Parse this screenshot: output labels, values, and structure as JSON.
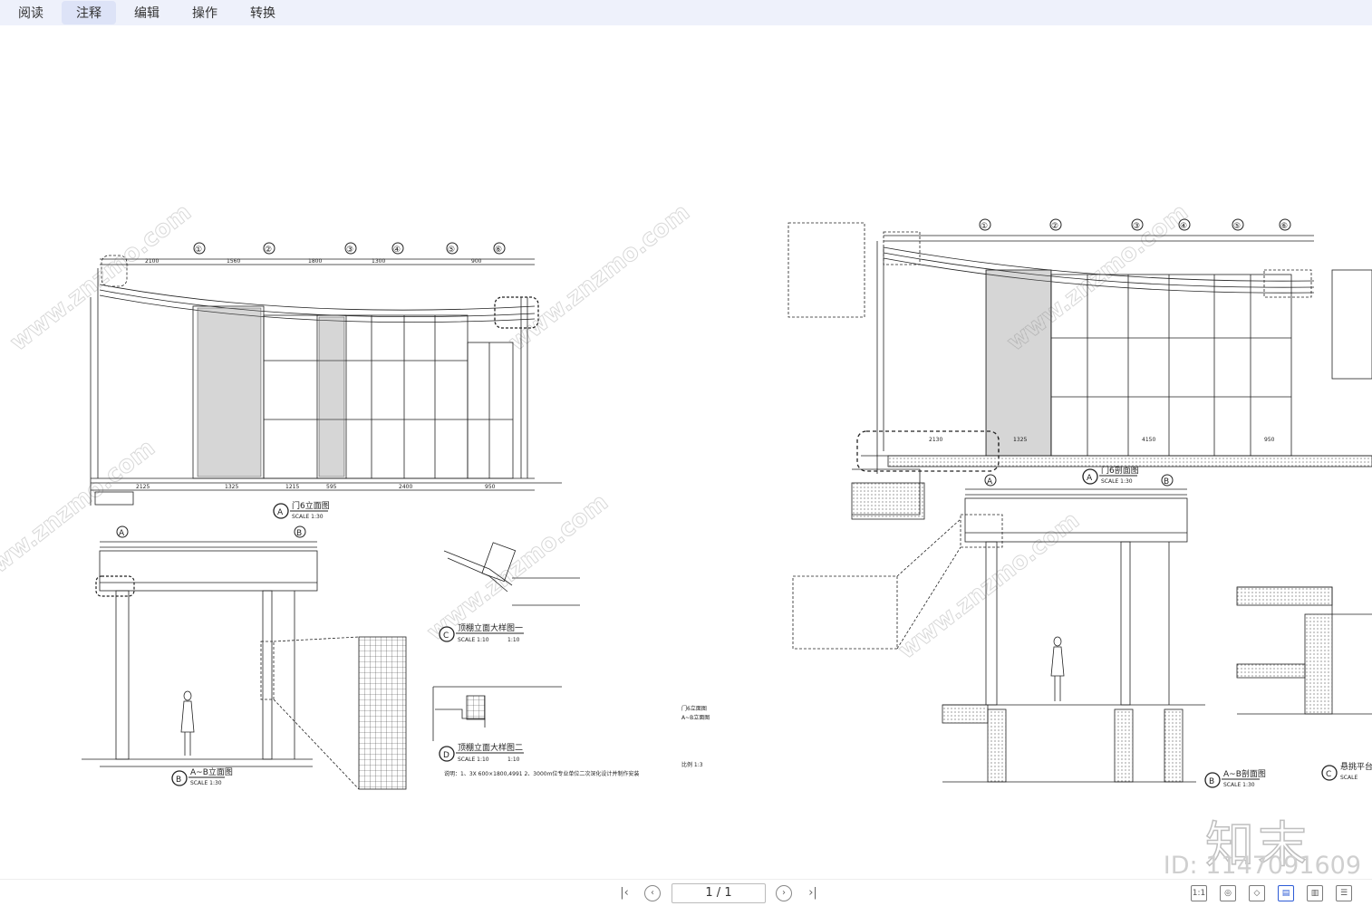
{
  "menu": {
    "items": [
      {
        "label": "阅读",
        "active": false
      },
      {
        "label": "注释",
        "active": true
      },
      {
        "label": "编辑",
        "active": false
      },
      {
        "label": "操作",
        "active": false
      },
      {
        "label": "转换",
        "active": false
      }
    ]
  },
  "drawing": {
    "watermark_text": "www.znzmo.com",
    "left": {
      "grid_labels": [
        "①",
        "②",
        "③",
        "④",
        "⑤",
        "⑥"
      ],
      "elevation_A": {
        "letter": "A",
        "title": "门6立面图",
        "scale": "SCALE 1:30"
      },
      "elevation_B": {
        "letter": "B",
        "title": "A~B立面图",
        "scale": "SCALE 1:30",
        "grid": [
          "A",
          "B"
        ]
      },
      "detail_C": {
        "letter": "C",
        "title": "顶棚立面大样图一",
        "scale": "SCALE 1:10"
      },
      "detail_D": {
        "letter": "D",
        "title": "顶棚立面大样图二",
        "scale": "SCALE 1:10"
      },
      "dims_top": [
        "2100",
        "1560",
        "1800",
        "1300",
        "900"
      ],
      "dims_bottom": [
        "2125",
        "1325",
        "1215",
        "595",
        "2400",
        "950"
      ],
      "note": "说明：1、3X 600×1800,4991  2、3000m位专业单位二次深化设计并制作安装"
    },
    "right": {
      "grid_labels": [
        "①",
        "②",
        "③",
        "④",
        "⑤",
        "⑥"
      ],
      "section_A": {
        "letter": "A",
        "title": "门6剖面图",
        "scale": "SCALE 1:30"
      },
      "section_B": {
        "letter": "B",
        "title": "A~B剖面图",
        "scale": "SCALE 1:30",
        "grid": [
          "A",
          "B"
        ]
      },
      "section_C": {
        "letter": "C",
        "title": "悬挑平台",
        "scale": "SCALE"
      },
      "dims_bottom": [
        "2130",
        "1325",
        "4150",
        "950"
      ]
    },
    "middle_notes": [
      "门6立面图",
      "A~B立面图",
      "比例 1:3"
    ]
  },
  "brand": {
    "logo": "知末",
    "id": "ID: 1147091609"
  },
  "pager": {
    "page": "1 / 1",
    "first_icon": "first-page-icon",
    "prev_icon": "prev-page-icon",
    "next_icon": "next-page-icon",
    "last_icon": "last-page-icon"
  },
  "tools": [
    {
      "name": "actual-size",
      "label": "1:1"
    },
    {
      "name": "fit-page",
      "label": "◎"
    },
    {
      "name": "fit-width",
      "label": "◇"
    },
    {
      "name": "single-page",
      "label": "▤"
    },
    {
      "name": "double-page",
      "label": "▥"
    },
    {
      "name": "continuous",
      "label": "☰"
    }
  ]
}
